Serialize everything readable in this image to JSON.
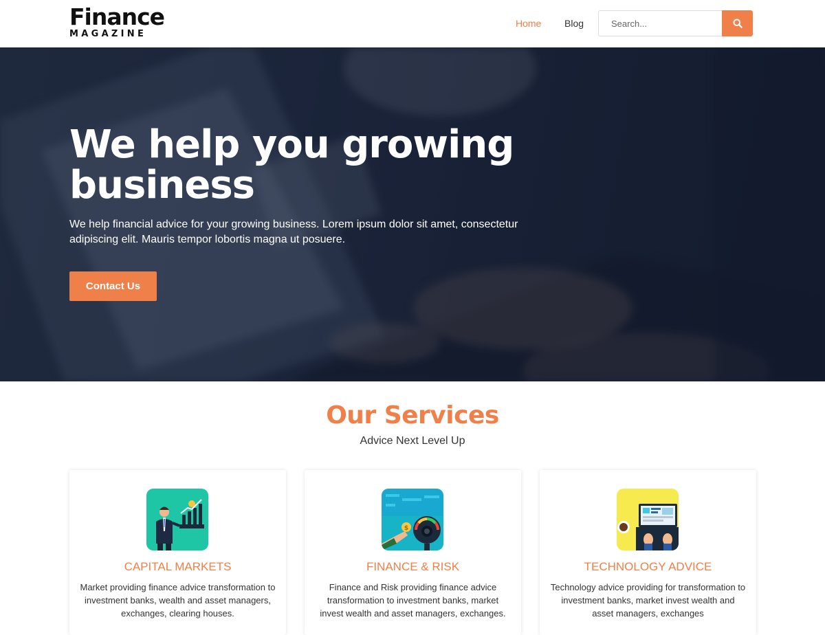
{
  "header": {
    "logo_title": "Finance",
    "logo_subtitle": "MAGAZINE",
    "nav": [
      {
        "label": "Home",
        "active": true
      },
      {
        "label": "Blog",
        "active": false
      }
    ],
    "search": {
      "placeholder": "Search...",
      "icon": "search-icon"
    }
  },
  "hero": {
    "title": "We help you growing business",
    "text": "We help financial advice for your growing business. Lorem ipsum dolor sit amet, consectetur adipiscing elit. Mauris tempor lobortis magna ut posuere.",
    "button_label": "Contact Us"
  },
  "services": {
    "title": "Our Services",
    "subtitle": "Advice Next Level Up",
    "cards": [
      {
        "icon": "businessman-growth-chart-icon",
        "icon_bg": "#1fc6a6",
        "title": "CAPITAL MARKETS",
        "text": "Market providing finance advice transformation to investment banks, wealth and asset managers, exchanges, clearing houses."
      },
      {
        "icon": "coin-gauge-icon",
        "icon_bg": "#16b4c6",
        "title": "FINANCE & RISK",
        "text": "Finance and Risk providing finance advice transformation to investment banks, market invest wealth and asset managers, exchanges."
      },
      {
        "icon": "laptop-typing-icon",
        "icon_bg": "#f7ea4f",
        "title": "TECHNOLOGY ADVICE",
        "text": "Technology advice providing for transformation to investment banks, market invest wealth and asset managers, exchanges"
      }
    ]
  },
  "colors": {
    "accent": "#f0804a",
    "hero_bg": "#1d2538",
    "text": "#333333"
  }
}
